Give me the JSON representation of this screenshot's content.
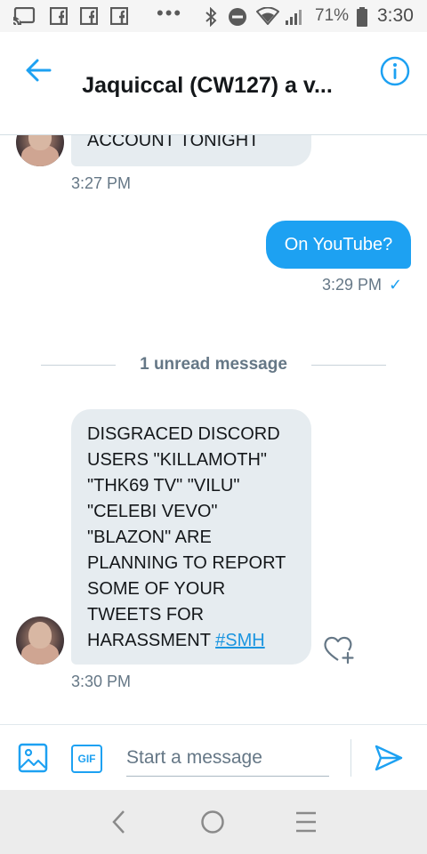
{
  "status_bar": {
    "battery_percent": "71%",
    "time": "3:30",
    "notification_dots": "•••",
    "icons": [
      "cast-icon",
      "facebook-icon",
      "facebook-icon",
      "facebook-icon",
      "more-dots-icon",
      "bluetooth-icon",
      "do-not-disturb-icon",
      "wifi-icon",
      "signal-icon",
      "battery-icon"
    ]
  },
  "header": {
    "title": "Jaquiccal (CW127) a v...",
    "back_icon": "arrow-left-icon",
    "info_icon": "info-icon"
  },
  "messages": [
    {
      "direction": "incoming",
      "text": "ACCOUNT TONIGHT",
      "time": "3:27 PM"
    },
    {
      "direction": "outgoing",
      "text": "On YouTube?",
      "time": "3:29 PM",
      "read_mark": "✓"
    },
    {
      "direction": "incoming",
      "lines": [
        "DISGRACED DISCORD",
        "USERS \"KILLAMOTH\"",
        "\"THK69 TV\" \"VILU\"",
        "\"CELEBI VEVO\"",
        "\"BLAZON\" ARE",
        "PLANNING TO REPORT",
        "SOME OF YOUR",
        "TWEETS FOR"
      ],
      "last_line_text": "HARASSMENT ",
      "hashtag": "#SMH",
      "time": "3:30 PM"
    }
  ],
  "unread_divider": {
    "label": "1 unread message"
  },
  "composer": {
    "placeholder": "Start a message",
    "value": "",
    "gif_label": "GIF"
  },
  "colors": {
    "accent": "#1da1f2",
    "bubble_in": "#e6ecf0",
    "muted_text": "#657786"
  }
}
